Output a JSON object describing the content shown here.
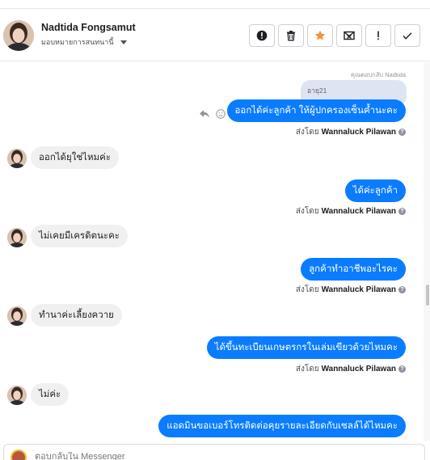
{
  "header": {
    "contact_name": "Nadtida Fongsamut",
    "assign_label": "มอบหมายการสนทนานี้",
    "actions": [
      {
        "name": "report-spam-button",
        "icon": "alert-circle-icon"
      },
      {
        "name": "delete-button",
        "icon": "trash-icon"
      },
      {
        "name": "star-button",
        "icon": "star-icon"
      },
      {
        "name": "mark-unread-button",
        "icon": "envelope-x-icon"
      },
      {
        "name": "follow-up-button",
        "icon": "exclamation-icon"
      },
      {
        "name": "mark-done-button",
        "icon": "check-icon"
      }
    ],
    "star_color": "#f7923b"
  },
  "thread": {
    "reply_note": "คุณตอบกลับ Nadtida",
    "quoted_text": "อายุ21",
    "messages": [
      {
        "dir": "out",
        "text": "ออกได้ค่ะลูกค้า ให้ผู้ปกครองเซ็นค้ำนะคะ",
        "sent_by_prefix": "ส่งโดย",
        "sent_by": "Wannaluck Pilawan"
      },
      {
        "dir": "in",
        "text": "ออกได้ยุใช่ไหมค่ะ"
      },
      {
        "dir": "out",
        "text": "ได้ค่ะลูกค้า",
        "sent_by_prefix": "ส่งโดย",
        "sent_by": "Wannaluck Pilawan"
      },
      {
        "dir": "in",
        "text": "ไม่เคยมีเครดิตนะคะ"
      },
      {
        "dir": "out",
        "text": "ลูกค้าทำอาชีพอะไรคะ",
        "sent_by_prefix": "ส่งโดย",
        "sent_by": "Wannaluck Pilawan"
      },
      {
        "dir": "in",
        "text": "ทำนาค่ะเลี้ยงควาย"
      },
      {
        "dir": "out",
        "text": "ได้ขึ้นทะเบียนเกษตรกรในเล่มเขียวด้วยไหมคะ",
        "sent_by_prefix": "ส่งโดย",
        "sent_by": "Wannaluck Pilawan"
      },
      {
        "dir": "in",
        "text": "ไม่ค่ะ"
      },
      {
        "dir": "out",
        "text": "แอดมินขอเบอร์โทรติดต่อคุยรายละเอียดกับเซลล์ได้ไหมคะ"
      }
    ],
    "bubble_color": "#0a7cff"
  },
  "composer": {
    "placeholder": "ตอบกลับใน Messenger"
  }
}
